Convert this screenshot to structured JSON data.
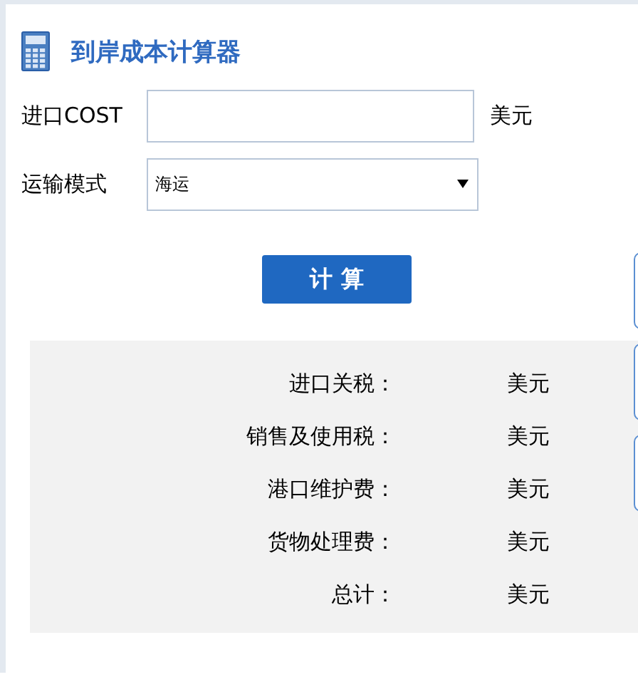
{
  "title": "到岸成本计算器",
  "form": [
    {
      "kind": "input",
      "label": "进口COST",
      "unit": "美元"
    },
    {
      "kind": "select",
      "label": "运输模式",
      "value": "海运"
    }
  ],
  "button": "计 算",
  "results": [
    {
      "label": "进口关税：",
      "unit": "美元"
    },
    {
      "label": "销售及使用税：",
      "unit": "美元"
    },
    {
      "label": "港口维护费：",
      "unit": "美元"
    },
    {
      "label": "货物处理费：",
      "unit": "美元"
    },
    {
      "label": "总计：",
      "unit": "美元"
    }
  ]
}
